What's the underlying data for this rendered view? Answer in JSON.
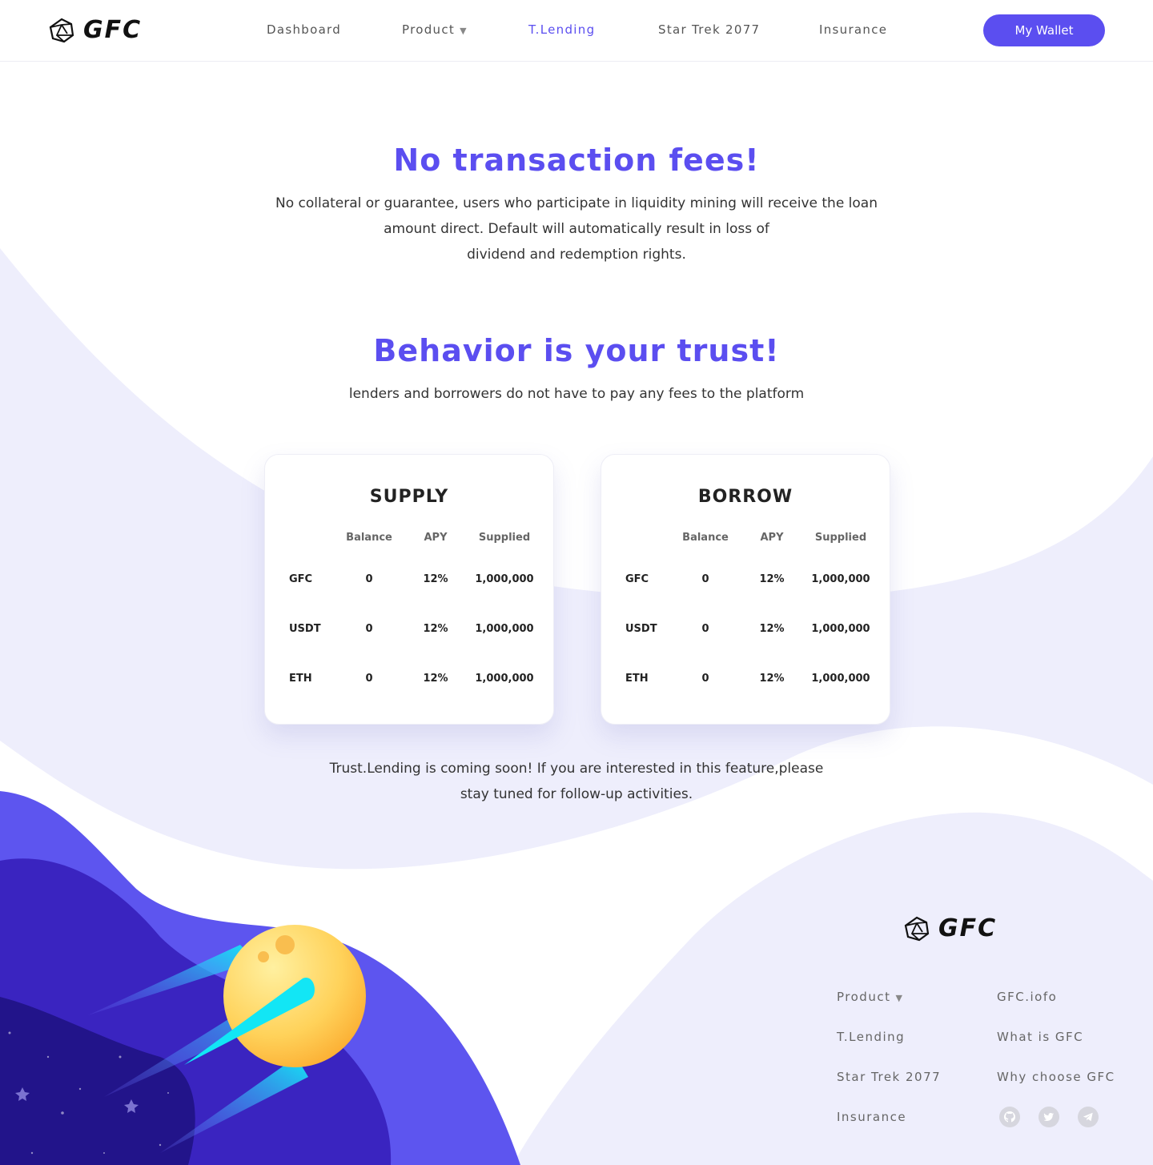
{
  "brand": {
    "name": "GFC",
    "accent": "#5b4ef0"
  },
  "nav": {
    "items": [
      "Dashboard",
      "Product",
      "T.Lending",
      "Star Trek 2077",
      "Insurance"
    ],
    "active": "T.Lending",
    "wallet_button": "My Wallet"
  },
  "hero": {
    "title1": "No transaction fees!",
    "desc1_line1": "No collateral or guarantee, users who participate in liquidity mining will receive the loan",
    "desc1_line2": "amount direct. Default will automatically result in loss of",
    "desc1_line3": "dividend and redemption rights.",
    "title2": "Behavior is your trust!",
    "desc2": "lenders and borrowers do not have to pay any fees to the platform"
  },
  "cards": [
    {
      "title": "SUPPLY",
      "headers": [
        "Balance",
        "APY",
        "Supplied"
      ],
      "rows": [
        {
          "asset": "GFC",
          "balance": "0",
          "apy": "12%",
          "supplied": "1,000,000"
        },
        {
          "asset": "USDT",
          "balance": "0",
          "apy": "12%",
          "supplied": "1,000,000"
        },
        {
          "asset": "ETH",
          "balance": "0",
          "apy": "12%",
          "supplied": "1,000,000"
        }
      ]
    },
    {
      "title": "BORROW",
      "headers": [
        "Balance",
        "APY",
        "Supplied"
      ],
      "rows": [
        {
          "asset": "GFC",
          "balance": "0",
          "apy": "12%",
          "supplied": "1,000,000"
        },
        {
          "asset": "USDT",
          "balance": "0",
          "apy": "12%",
          "supplied": "1,000,000"
        },
        {
          "asset": "ETH",
          "balance": "0",
          "apy": "12%",
          "supplied": "1,000,000"
        }
      ]
    }
  ],
  "notice": {
    "line1": "Trust.Lending is coming soon!  If you are interested in this feature,please",
    "line2": "stay tuned for follow-up activities."
  },
  "footer": {
    "brand": "GFC",
    "col1": [
      "Product",
      "T.Lending",
      "Star Trek 2077",
      "Insurance"
    ],
    "col2": [
      "GFC.iofo",
      "What is GFC",
      "Why choose GFC"
    ],
    "social": [
      "github-icon",
      "twitter-icon",
      "telegram-icon"
    ]
  }
}
